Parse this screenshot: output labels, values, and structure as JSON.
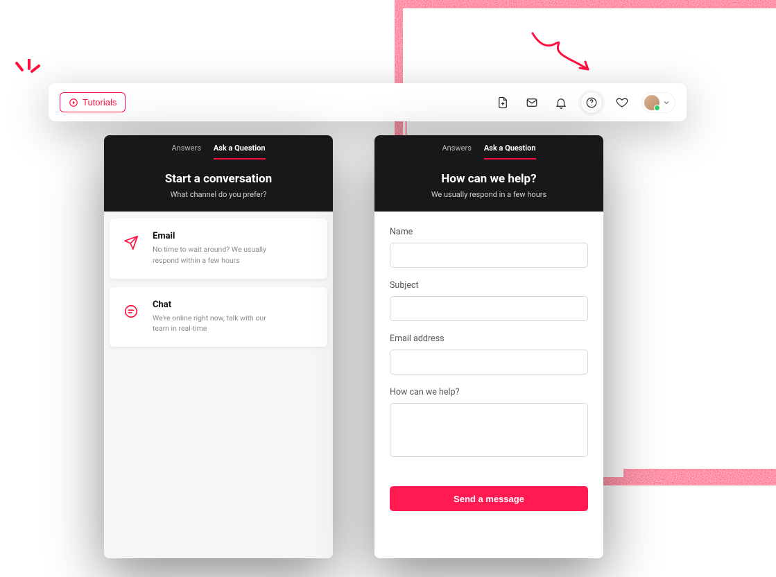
{
  "colors": {
    "accent": "#ff103f",
    "send": "#ff1a52"
  },
  "topbar": {
    "tutorials_label": "Tutorials"
  },
  "left_panel": {
    "tabs": {
      "answers": "Answers",
      "ask": "Ask a Question"
    },
    "title": "Start a conversation",
    "subtitle": "What channel do you prefer?",
    "channels": [
      {
        "title": "Email",
        "desc": "No time to wait around? We usually respond within a few hours"
      },
      {
        "title": "Chat",
        "desc": "We're online right now, talk with our team in real-time"
      }
    ]
  },
  "right_panel": {
    "tabs": {
      "answers": "Answers",
      "ask": "Ask a Question"
    },
    "title": "How can we help?",
    "subtitle": "We usually respond in a few hours",
    "form": {
      "name_label": "Name",
      "subject_label": "Subject",
      "email_label": "Email address",
      "help_label": "How can we help?",
      "send_label": "Send a message"
    }
  }
}
